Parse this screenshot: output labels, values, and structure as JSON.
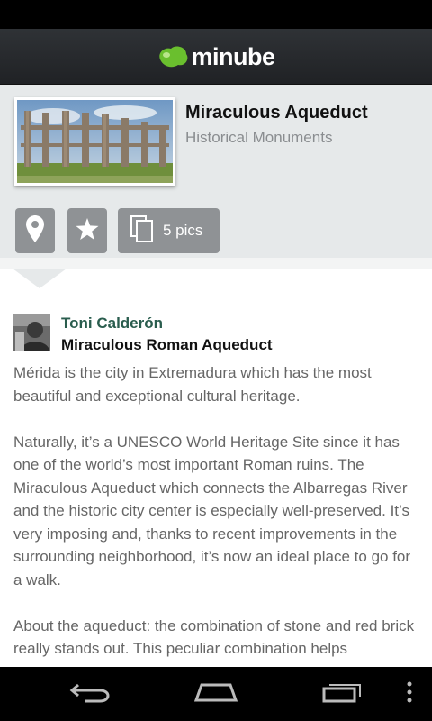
{
  "app": {
    "logo_text": "minube",
    "brand_color": "#6abf2e"
  },
  "place": {
    "title": "Miraculous Aqueduct",
    "category": "Historical Monuments",
    "image_icon": "aqueduct-photo"
  },
  "actions": {
    "location_icon": "map-pin-icon",
    "favorite_icon": "star-icon",
    "pics_icon": "gallery-icon",
    "pics_label": "5 pics"
  },
  "review": {
    "author": "Toni Calderón",
    "title": "Miraculous Roman Aqueduct",
    "paragraphs": [
      "Mérida is the city in Extremadura which has the most beautiful and exceptional cultural heritage.",
      "Naturally, it’s a UNESCO World Heritage Site since it has one of the world’s most important Roman ruins. The Miraculous Aqueduct which connects the Albarregas River and the historic city center is especially well-preserved. It’s very imposing and, thanks to recent improvements in the surrounding neighborhood, it’s now an ideal place to go for a walk.",
      "About the aqueduct: the combination of stone and red brick really stands out. This peculiar combination helps"
    ]
  },
  "nav": {
    "back_icon": "back-icon",
    "home_icon": "home-icon",
    "recents_icon": "recents-icon",
    "menu_icon": "overflow-menu-icon"
  }
}
